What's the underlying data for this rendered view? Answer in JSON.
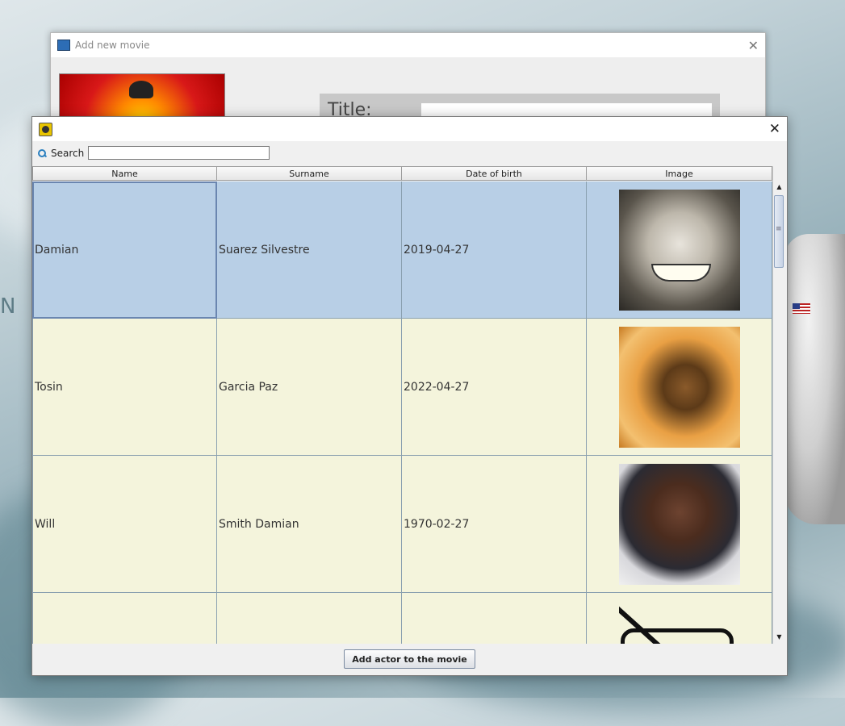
{
  "back_window": {
    "title": "Add new movie",
    "title_label": "Title:"
  },
  "dialog": {
    "search": {
      "label": "Search",
      "value": ""
    },
    "table": {
      "columns": [
        {
          "label": "Name"
        },
        {
          "label": "Surname"
        },
        {
          "label": "Date of birth"
        },
        {
          "label": "Image"
        }
      ],
      "rows": [
        {
          "name": "Damian",
          "surname": "Suarez Silvestre",
          "dob": "2019-04-27",
          "image": "cat-photo",
          "selected": true
        },
        {
          "name": "Tosin",
          "surname": "Garcia Paz",
          "dob": "2022-04-27",
          "image": "hedgehog-photo",
          "selected": false
        },
        {
          "name": "Will",
          "surname": "Smith Damian",
          "dob": "1970-02-27",
          "image": "man-portrait-photo",
          "selected": false
        },
        {
          "name": "",
          "surname": "",
          "dob": "",
          "image": "no-photo-icon",
          "selected": false
        }
      ]
    },
    "add_button_label": "Add  actor to the movie"
  }
}
